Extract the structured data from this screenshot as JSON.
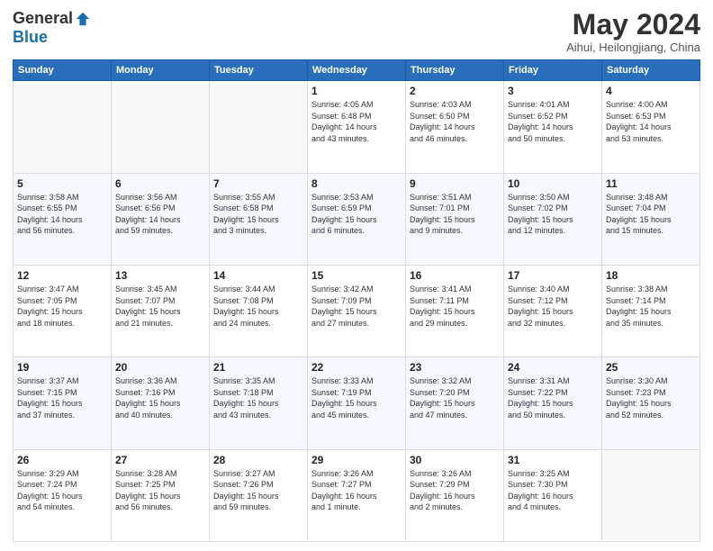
{
  "header": {
    "logo_general": "General",
    "logo_blue": "Blue",
    "main_title": "May 2024",
    "subtitle": "Aihui, Heilongjiang, China"
  },
  "calendar": {
    "days_of_week": [
      "Sunday",
      "Monday",
      "Tuesday",
      "Wednesday",
      "Thursday",
      "Friday",
      "Saturday"
    ],
    "weeks": [
      [
        {
          "day": "",
          "info": ""
        },
        {
          "day": "",
          "info": ""
        },
        {
          "day": "",
          "info": ""
        },
        {
          "day": "1",
          "info": "Sunrise: 4:05 AM\nSunset: 6:48 PM\nDaylight: 14 hours\nand 43 minutes."
        },
        {
          "day": "2",
          "info": "Sunrise: 4:03 AM\nSunset: 6:50 PM\nDaylight: 14 hours\nand 46 minutes."
        },
        {
          "day": "3",
          "info": "Sunrise: 4:01 AM\nSunset: 6:52 PM\nDaylight: 14 hours\nand 50 minutes."
        },
        {
          "day": "4",
          "info": "Sunrise: 4:00 AM\nSunset: 6:53 PM\nDaylight: 14 hours\nand 53 minutes."
        }
      ],
      [
        {
          "day": "5",
          "info": "Sunrise: 3:58 AM\nSunset: 6:55 PM\nDaylight: 14 hours\nand 56 minutes."
        },
        {
          "day": "6",
          "info": "Sunrise: 3:56 AM\nSunset: 6:56 PM\nDaylight: 14 hours\nand 59 minutes."
        },
        {
          "day": "7",
          "info": "Sunrise: 3:55 AM\nSunset: 6:58 PM\nDaylight: 15 hours\nand 3 minutes."
        },
        {
          "day": "8",
          "info": "Sunrise: 3:53 AM\nSunset: 6:59 PM\nDaylight: 15 hours\nand 6 minutes."
        },
        {
          "day": "9",
          "info": "Sunrise: 3:51 AM\nSunset: 7:01 PM\nDaylight: 15 hours\nand 9 minutes."
        },
        {
          "day": "10",
          "info": "Sunrise: 3:50 AM\nSunset: 7:02 PM\nDaylight: 15 hours\nand 12 minutes."
        },
        {
          "day": "11",
          "info": "Sunrise: 3:48 AM\nSunset: 7:04 PM\nDaylight: 15 hours\nand 15 minutes."
        }
      ],
      [
        {
          "day": "12",
          "info": "Sunrise: 3:47 AM\nSunset: 7:05 PM\nDaylight: 15 hours\nand 18 minutes."
        },
        {
          "day": "13",
          "info": "Sunrise: 3:45 AM\nSunset: 7:07 PM\nDaylight: 15 hours\nand 21 minutes."
        },
        {
          "day": "14",
          "info": "Sunrise: 3:44 AM\nSunset: 7:08 PM\nDaylight: 15 hours\nand 24 minutes."
        },
        {
          "day": "15",
          "info": "Sunrise: 3:42 AM\nSunset: 7:09 PM\nDaylight: 15 hours\nand 27 minutes."
        },
        {
          "day": "16",
          "info": "Sunrise: 3:41 AM\nSunset: 7:11 PM\nDaylight: 15 hours\nand 29 minutes."
        },
        {
          "day": "17",
          "info": "Sunrise: 3:40 AM\nSunset: 7:12 PM\nDaylight: 15 hours\nand 32 minutes."
        },
        {
          "day": "18",
          "info": "Sunrise: 3:38 AM\nSunset: 7:14 PM\nDaylight: 15 hours\nand 35 minutes."
        }
      ],
      [
        {
          "day": "19",
          "info": "Sunrise: 3:37 AM\nSunset: 7:15 PM\nDaylight: 15 hours\nand 37 minutes."
        },
        {
          "day": "20",
          "info": "Sunrise: 3:36 AM\nSunset: 7:16 PM\nDaylight: 15 hours\nand 40 minutes."
        },
        {
          "day": "21",
          "info": "Sunrise: 3:35 AM\nSunset: 7:18 PM\nDaylight: 15 hours\nand 43 minutes."
        },
        {
          "day": "22",
          "info": "Sunrise: 3:33 AM\nSunset: 7:19 PM\nDaylight: 15 hours\nand 45 minutes."
        },
        {
          "day": "23",
          "info": "Sunrise: 3:32 AM\nSunset: 7:20 PM\nDaylight: 15 hours\nand 47 minutes."
        },
        {
          "day": "24",
          "info": "Sunrise: 3:31 AM\nSunset: 7:22 PM\nDaylight: 15 hours\nand 50 minutes."
        },
        {
          "day": "25",
          "info": "Sunrise: 3:30 AM\nSunset: 7:23 PM\nDaylight: 15 hours\nand 52 minutes."
        }
      ],
      [
        {
          "day": "26",
          "info": "Sunrise: 3:29 AM\nSunset: 7:24 PM\nDaylight: 15 hours\nand 54 minutes."
        },
        {
          "day": "27",
          "info": "Sunrise: 3:28 AM\nSunset: 7:25 PM\nDaylight: 15 hours\nand 56 minutes."
        },
        {
          "day": "28",
          "info": "Sunrise: 3:27 AM\nSunset: 7:26 PM\nDaylight: 15 hours\nand 59 minutes."
        },
        {
          "day": "29",
          "info": "Sunrise: 3:26 AM\nSunset: 7:27 PM\nDaylight: 16 hours\nand 1 minute."
        },
        {
          "day": "30",
          "info": "Sunrise: 3:26 AM\nSunset: 7:29 PM\nDaylight: 16 hours\nand 2 minutes."
        },
        {
          "day": "31",
          "info": "Sunrise: 3:25 AM\nSunset: 7:30 PM\nDaylight: 16 hours\nand 4 minutes."
        },
        {
          "day": "",
          "info": ""
        }
      ]
    ]
  }
}
